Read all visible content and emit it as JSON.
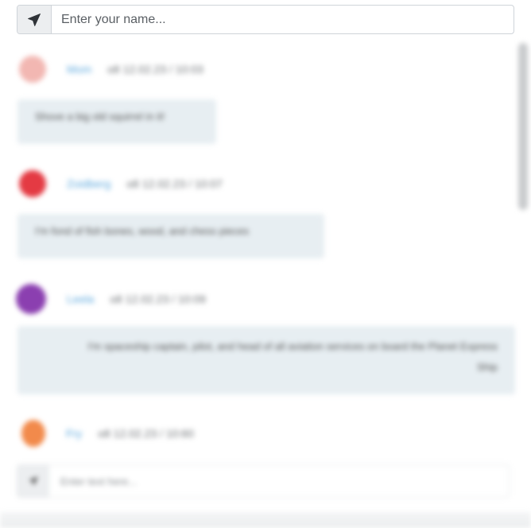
{
  "name_bar": {
    "placeholder": "Enter your name...",
    "icon": "paper-plane-icon"
  },
  "messages": [
    {
      "username": "Mom",
      "timestamp": "o8 12.02.23 / 10:03",
      "text": "Shove a big old squirrel in it!",
      "avatar_color": "#f2b7b2"
    },
    {
      "username": "Zoidberg",
      "timestamp": "o8 12.02.23 / 10:07",
      "text": "I'm fond of fish bones, wood, and chess pieces",
      "avatar_color": "#e43a43"
    },
    {
      "username": "Leela",
      "timestamp": "o8 12.02.23 / 10:09",
      "text": "I'm spaceship captain, pilot, and head of all aviation services on board the Planet Express Ship",
      "avatar_color": "#8b3fb0"
    },
    {
      "username": "Fry",
      "timestamp": "o8 12.02.23 / 10:60",
      "text": "",
      "avatar_color": "#f28a4b"
    }
  ],
  "message_bar": {
    "placeholder": "Enter text here...",
    "icon": "paper-plane-icon"
  }
}
